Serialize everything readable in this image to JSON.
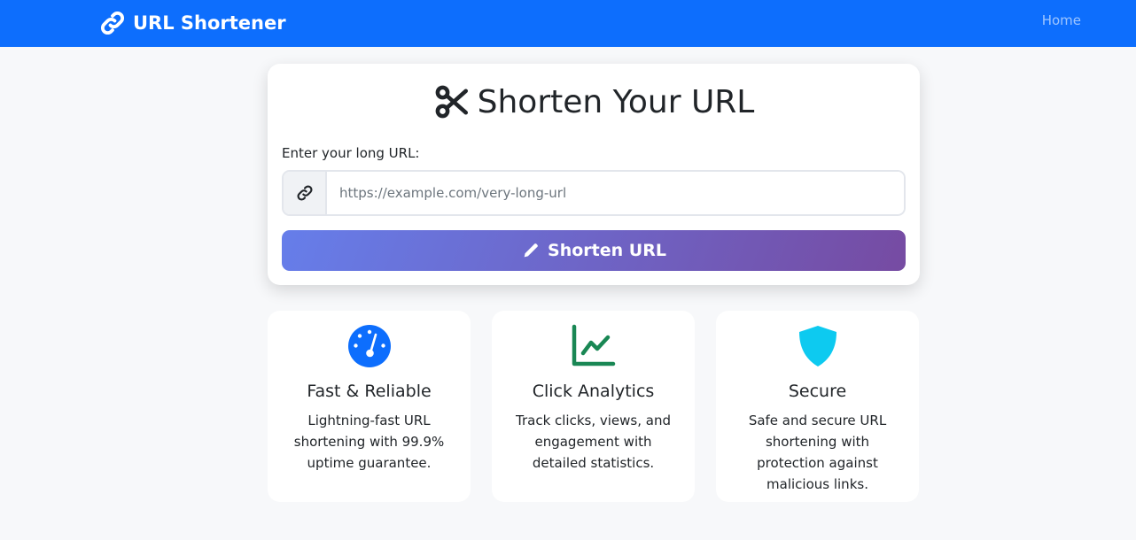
{
  "navbar": {
    "brand": "URL Shortener",
    "home_link": "Home"
  },
  "shortener": {
    "title": "Shorten Your URL",
    "input_label": "Enter your long URL:",
    "input_placeholder": "https://example.com/very-long-url",
    "input_value": "",
    "button_label": "Shorten URL"
  },
  "features": [
    {
      "icon": "speedometer-icon",
      "title": "Fast & Reliable",
      "description": "Lightning-fast URL shortening with 99.9% uptime guarantee."
    },
    {
      "icon": "line-chart-icon",
      "title": "Click Analytics",
      "description": "Track clicks, views, and engagement with detailed statistics."
    },
    {
      "icon": "shield-icon",
      "title": "Secure",
      "description": "Safe and secure URL shortening with protection against malicious links."
    }
  ],
  "colors": {
    "navbar": "#0d6efd",
    "button_gradient_start": "#667eea",
    "button_gradient_end": "#764ba2",
    "speed_icon": "#0d6efd",
    "analytics_icon": "#198754",
    "secure_icon": "#0dcaf0",
    "background": "#f7f8fa"
  }
}
